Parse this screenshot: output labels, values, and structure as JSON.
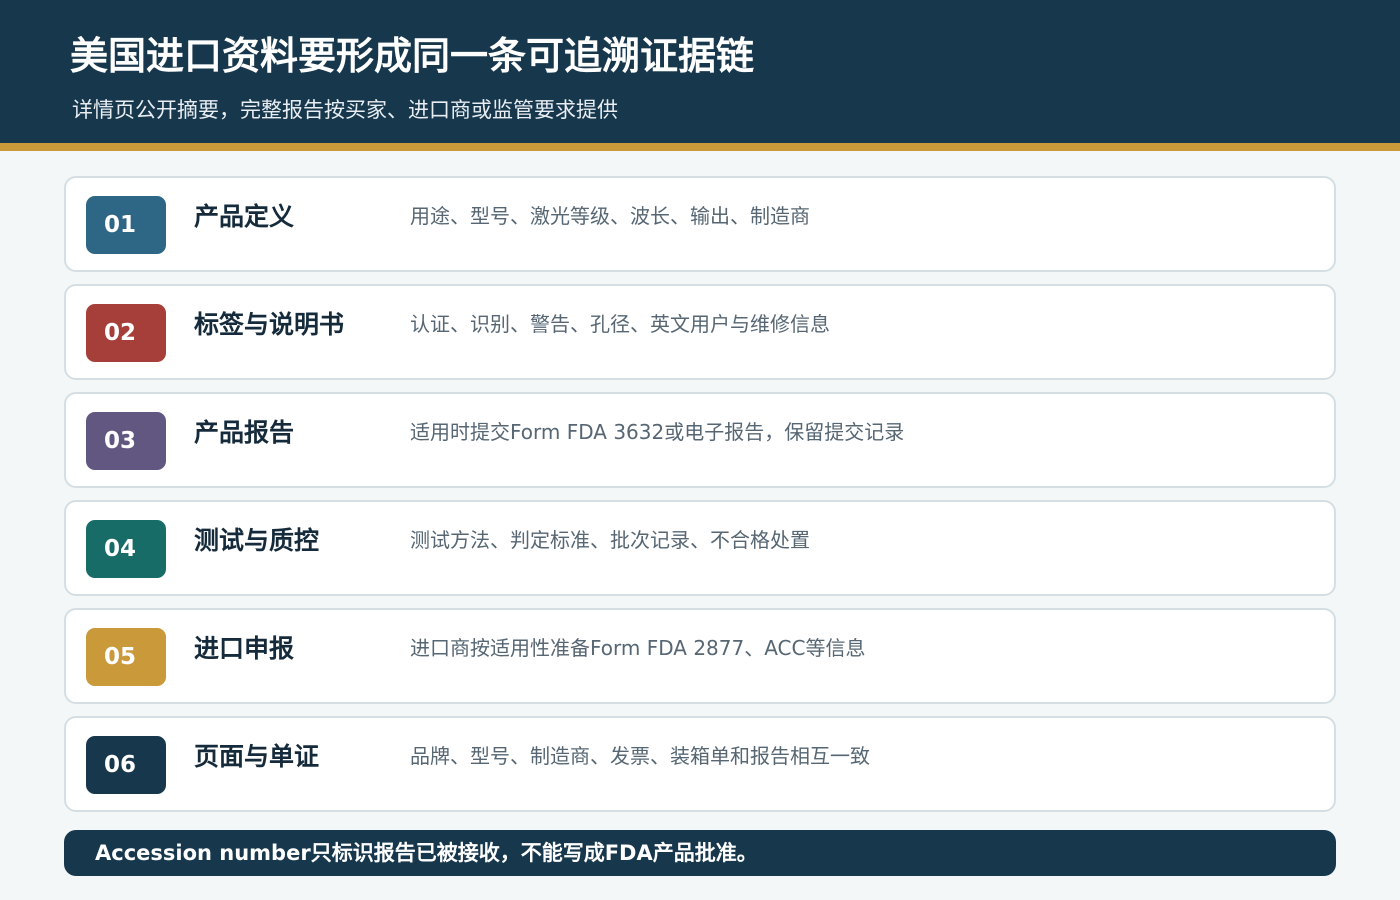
{
  "header": {
    "title": "美国进口资料要形成同一条可追溯证据链",
    "subtitle": "详情页公开摘要，完整报告按买家、进口商或监管要求提供"
  },
  "steps": [
    {
      "number": "01",
      "title": "产品定义",
      "description": "用途、型号、激光等级、波长、输出、制造商",
      "color": "#2e6685"
    },
    {
      "number": "02",
      "title": "标签与说明书",
      "description": "认证、识别、警告、孔径、英文用户与维修信息",
      "color": "#a63f39"
    },
    {
      "number": "03",
      "title": "产品报告",
      "description": "适用时提交Form FDA 3632或电子报告，保留提交记录",
      "color": "#625780"
    },
    {
      "number": "04",
      "title": "测试与质控",
      "description": "测试方法、判定标准、批次记录、不合格处置",
      "color": "#186c67"
    },
    {
      "number": "05",
      "title": "进口申报",
      "description": "进口商按适用性准备Form FDA 2877、ACC等信息",
      "color": "#c9993a"
    },
    {
      "number": "06",
      "title": "页面与单证",
      "description": "品牌、型号、制造商、发票、装箱单和报告相互一致",
      "color": "#17374d"
    }
  ],
  "notice": {
    "text": "Accession number只标识报告已被接收，不能写成FDA产品批准。"
  },
  "colors": {
    "header_background": "#17374d",
    "accent_gold": "#c9993a",
    "page_background": "#f3f7f8"
  }
}
